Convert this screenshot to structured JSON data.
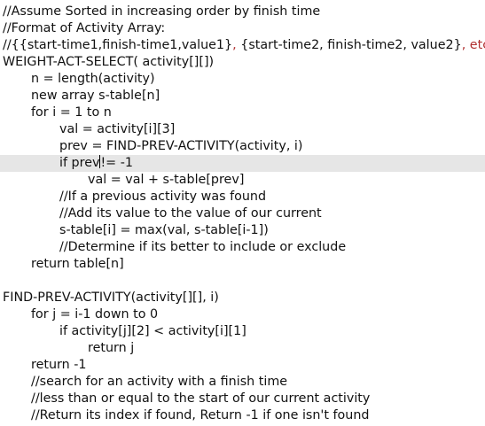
{
  "editor": {
    "current_line_color": "#e6e6e6",
    "text_color": "#111111",
    "highlight_color": "#b03030",
    "lines": [
      {
        "indent": 0,
        "segments": [
          {
            "text": "//Assume Sorted in increasing order by finish time",
            "hl": false
          }
        ]
      },
      {
        "indent": 0,
        "segments": [
          {
            "text": "//Format of Activity Array:",
            "hl": false
          }
        ]
      },
      {
        "indent": 0,
        "segments": [
          {
            "text": "//{",
            "hl": false
          },
          {
            "text": "{start-time1,finish-time1,value1}",
            "hl": false
          },
          {
            "text": ", ",
            "hl": true
          },
          {
            "text": "{start-time2, finish-time2, value2}",
            "hl": false
          },
          {
            "text": ", etc}",
            "hl": true
          }
        ]
      },
      {
        "indent": 0,
        "segments": [
          {
            "text": "WEIGHT-ACT-SELECT( activity[][])",
            "hl": false
          }
        ]
      },
      {
        "indent": 1,
        "segments": [
          {
            "text": "n = length(activity)",
            "hl": false
          }
        ]
      },
      {
        "indent": 1,
        "segments": [
          {
            "text": "new array s-table[n]",
            "hl": false
          }
        ]
      },
      {
        "indent": 1,
        "segments": [
          {
            "text": "for i = 1 to n",
            "hl": false
          }
        ]
      },
      {
        "indent": 2,
        "segments": [
          {
            "text": "val = activity[i][3]",
            "hl": false
          }
        ]
      },
      {
        "indent": 2,
        "segments": [
          {
            "text": "prev = FIND-PREV-ACTIVITY(activity, i)",
            "hl": false
          }
        ]
      },
      {
        "indent": 2,
        "current": true,
        "caret_after": 0,
        "segments": [
          {
            "text": "if prev",
            "hl": false
          },
          {
            "text": "!= -1",
            "hl": false
          }
        ]
      },
      {
        "indent": 3,
        "segments": [
          {
            "text": "val = val + s-table[prev]",
            "hl": false
          }
        ]
      },
      {
        "indent": 2,
        "segments": [
          {
            "text": "//If a previous activity was found",
            "hl": false
          }
        ]
      },
      {
        "indent": 2,
        "segments": [
          {
            "text": "//Add its value to the value of our current",
            "hl": false
          }
        ]
      },
      {
        "indent": 2,
        "segments": [
          {
            "text": "s-table[i] = max(val, s-table[i-1])",
            "hl": false
          }
        ]
      },
      {
        "indent": 2,
        "segments": [
          {
            "text": "//Determine if its better to include or exclude",
            "hl": false
          }
        ]
      },
      {
        "indent": 1,
        "segments": [
          {
            "text": "return table[n]",
            "hl": false
          }
        ]
      },
      {
        "indent": 0,
        "segments": [
          {
            "text": "",
            "hl": false
          }
        ]
      },
      {
        "indent": 0,
        "segments": [
          {
            "text": "FIND-PREV-ACTIVITY(activity[][], i)",
            "hl": false
          }
        ]
      },
      {
        "indent": 1,
        "segments": [
          {
            "text": "for j = i-1 down to 0",
            "hl": false
          }
        ]
      },
      {
        "indent": 2,
        "segments": [
          {
            "text": "if activity[j][2] < activity[i][1]",
            "hl": false
          }
        ]
      },
      {
        "indent": 3,
        "segments": [
          {
            "text": "return j",
            "hl": false
          }
        ]
      },
      {
        "indent": 1,
        "segments": [
          {
            "text": "return -1",
            "hl": false
          }
        ]
      },
      {
        "indent": 1,
        "segments": [
          {
            "text": "//search for an activity with a finish time",
            "hl": false
          }
        ]
      },
      {
        "indent": 1,
        "segments": [
          {
            "text": "//less than or equal to the start of our current activity",
            "hl": false
          }
        ]
      },
      {
        "indent": 1,
        "segments": [
          {
            "text": "//Return its index if found, Return -1 if one isn't found",
            "hl": false
          }
        ]
      }
    ]
  }
}
